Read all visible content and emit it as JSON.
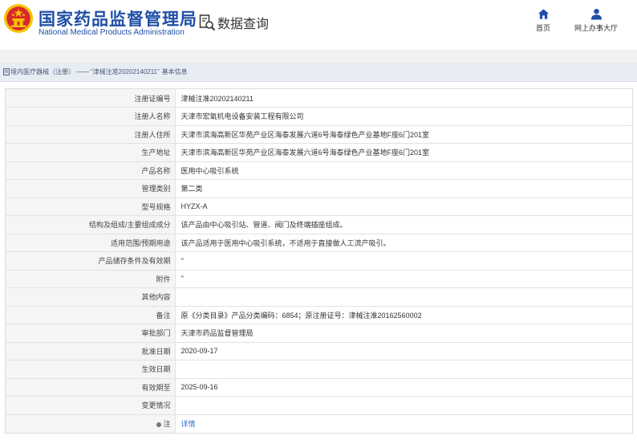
{
  "header": {
    "title_cn": "国家药品监督管理局",
    "title_en": "National Medical Products Administration",
    "query_label": "数据查询",
    "nav": [
      {
        "label": "首页",
        "icon": "home-icon"
      },
      {
        "label": "网上办事大厅",
        "icon": "user-icon"
      }
    ]
  },
  "breadcrumb": {
    "icon": "document-icon",
    "item1": "境内医疗器械（注册）",
    "separator": "——",
    "item2": "“津械注准20202140211”",
    "item3": "基本信息"
  },
  "record": {
    "rows": [
      {
        "label": "注册证编号",
        "value": "津械注准20202140211"
      },
      {
        "label": "注册人名称",
        "value": "天津市宏氧机电设备安装工程有限公司"
      },
      {
        "label": "注册人住所",
        "value": "天津市滨海高新区华苑产业区海泰发展六道6号海泰绿色产业基地F座6门201室"
      },
      {
        "label": "生产地址",
        "value": "天津市滨海高新区华苑产业区海泰发展六道6号海泰绿色产业基地F座6门201室"
      },
      {
        "label": "产品名称",
        "value": "医用中心吸引系统"
      },
      {
        "label": "管理类别",
        "value": "第二类"
      },
      {
        "label": "型号规格",
        "value": "HYZX-A"
      },
      {
        "label": "结构及组成/主要组成成分",
        "value": "该产品由中心吸引站、管道、阀门及终端插座组成。"
      },
      {
        "label": "适用范围/预期用途",
        "value": "该产品适用于医用中心吸引系统，不适用于直接做人工流产吸引。"
      },
      {
        "label": "产品储存条件及有效期",
        "value": "''"
      },
      {
        "label": "附件",
        "value": "''"
      },
      {
        "label": "其他内容",
        "value": ""
      },
      {
        "label": "备注",
        "value": "原《分类目录》产品分类编码：6854；原注册证号：津械注准20162560002"
      },
      {
        "label": "审批部门",
        "value": "天津市药品监督管理局"
      },
      {
        "label": "批准日期",
        "value": "2020-09-17"
      },
      {
        "label": "生效日期",
        "value": ""
      },
      {
        "label": "有效期至",
        "value": "2025-09-16"
      },
      {
        "label": "变更情况",
        "value": ""
      }
    ],
    "note_row": {
      "label": "注",
      "value": "详情",
      "icon": "dot-icon"
    }
  },
  "colors": {
    "brand_blue": "#1f4fa6",
    "link_blue": "#2c6cc9",
    "emblem_red": "#d9272e",
    "emblem_gold": "#f5c400"
  }
}
